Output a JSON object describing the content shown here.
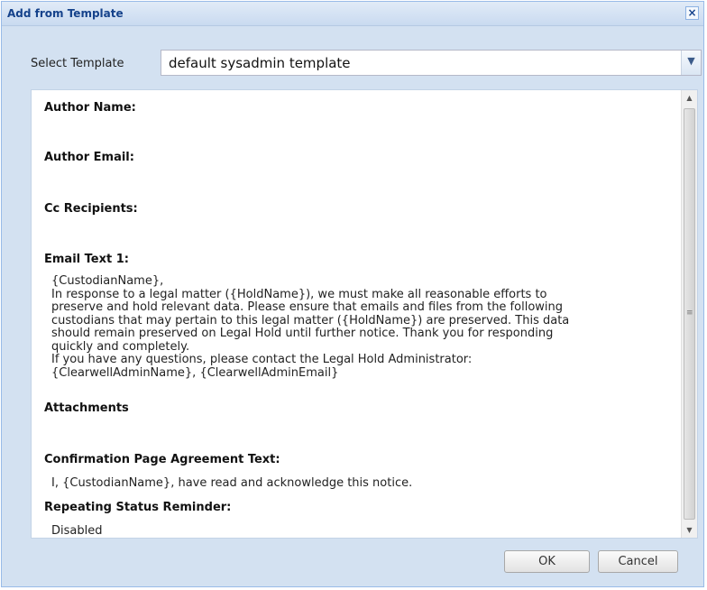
{
  "dialog": {
    "title": "Add from Template",
    "close_glyph": "×"
  },
  "template_select": {
    "label": "Select Template",
    "value": "default sysadmin template",
    "trigger_glyph": "▼"
  },
  "content": {
    "author_name_heading": "Author Name:",
    "author_email_heading": "Author Email:",
    "cc_heading": "Cc Recipients:",
    "email_text_heading": "Email Text 1:",
    "email_lines": [
      "{CustodianName},",
      "In response to a legal matter ({HoldName}), we must make all reasonable efforts to",
      "preserve and hold relevant data. Please ensure that emails and files from the following",
      "custodians that may pertain to this legal matter ({HoldName}) are preserved. This data",
      "should remain preserved on Legal Hold until further notice. Thank you for responding",
      "quickly and completely.",
      "If you have any questions, please contact the Legal Hold Administrator:",
      "{ClearwellAdminName}, {ClearwellAdminEmail}"
    ],
    "attachments_heading": "Attachments",
    "confirmation_heading": "Confirmation Page Agreement Text:",
    "confirmation_text": "I, {CustodianName}, have read and acknowledge this notice.",
    "reminder_heading": "Repeating Status Reminder:",
    "reminder_value": "Disabled"
  },
  "scrollbar": {
    "up_glyph": "▲",
    "down_glyph": "▼",
    "grip_glyph": "≡"
  },
  "buttons": {
    "ok_label": "OK",
    "cancel_label": "Cancel"
  },
  "colors": {
    "dialog_background": "#d3e1f1",
    "title_text": "#15428b"
  }
}
